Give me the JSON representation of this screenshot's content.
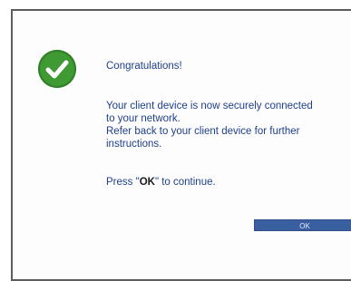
{
  "dialog": {
    "title": "Congratulations!",
    "message_line1": "Your client device is now securely connected",
    "message_line2": "to your network.",
    "message_line3": "Refer back to your client device for further",
    "message_line4": "instructions.",
    "press_prefix": "Press \"",
    "press_key": "OK",
    "press_suffix": "\" to continue.",
    "ok_label": "OK"
  },
  "icon": {
    "name": "success-check-icon",
    "color": "#3f9a34"
  }
}
